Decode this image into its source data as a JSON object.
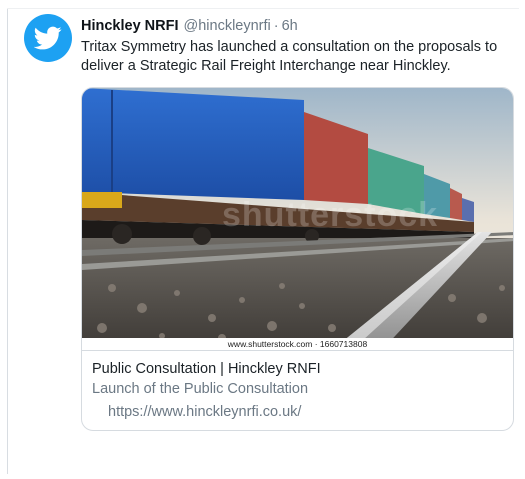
{
  "tweet": {
    "avatar_icon": "twitter-bird-icon",
    "avatar_color": "#1da1f2",
    "display_name": "Hinckley NRFI",
    "handle": "@hinckleynrfi",
    "separator": "·",
    "time": "6h",
    "text": "Tritax Symmetry has launched a consultation on the proposals to deliver a Strategic Rail Freight Interchange near Hinckley."
  },
  "card": {
    "watermark": "shutterstock",
    "image_credit": "www.shutterstock.com · 1660713808",
    "title": "Public Consultation | Hinckley RNFI",
    "description": "Launch of the Public Consultation",
    "url": "https://www.hinckleynrfi.co.uk/"
  }
}
